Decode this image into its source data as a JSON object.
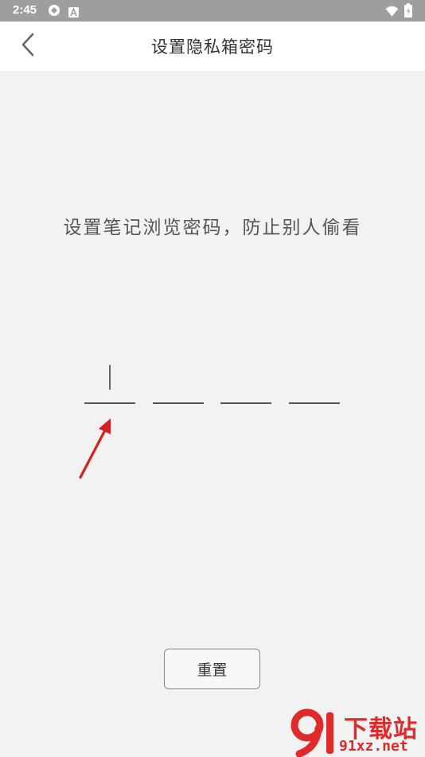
{
  "status_bar": {
    "time": "2:45",
    "left_icons": [
      "sync-icon",
      "notification-a-icon"
    ],
    "right_icons": [
      "wifi-icon",
      "battery-icon"
    ]
  },
  "header": {
    "back_icon": "chevron-left-icon",
    "title": "设置隐私箱密码"
  },
  "main": {
    "prompt": "设置笔记浏览密码，防止别人偷看",
    "pin_slots": [
      {
        "index": 1,
        "value": "",
        "focused": true
      },
      {
        "index": 2,
        "value": "",
        "focused": false
      },
      {
        "index": 3,
        "value": "",
        "focused": false
      },
      {
        "index": 4,
        "value": "",
        "focused": false
      }
    ],
    "reset_label": "重置"
  },
  "annotation": {
    "arrow_color": "#d62020"
  },
  "watermark": {
    "top_text": "下载站",
    "bottom_text": "91xz.net",
    "color": "#e02a2a"
  },
  "colors": {
    "background": "#f2f2f2",
    "header_bg": "#ffffff",
    "status_bar_bg": "#9e9e9e"
  }
}
